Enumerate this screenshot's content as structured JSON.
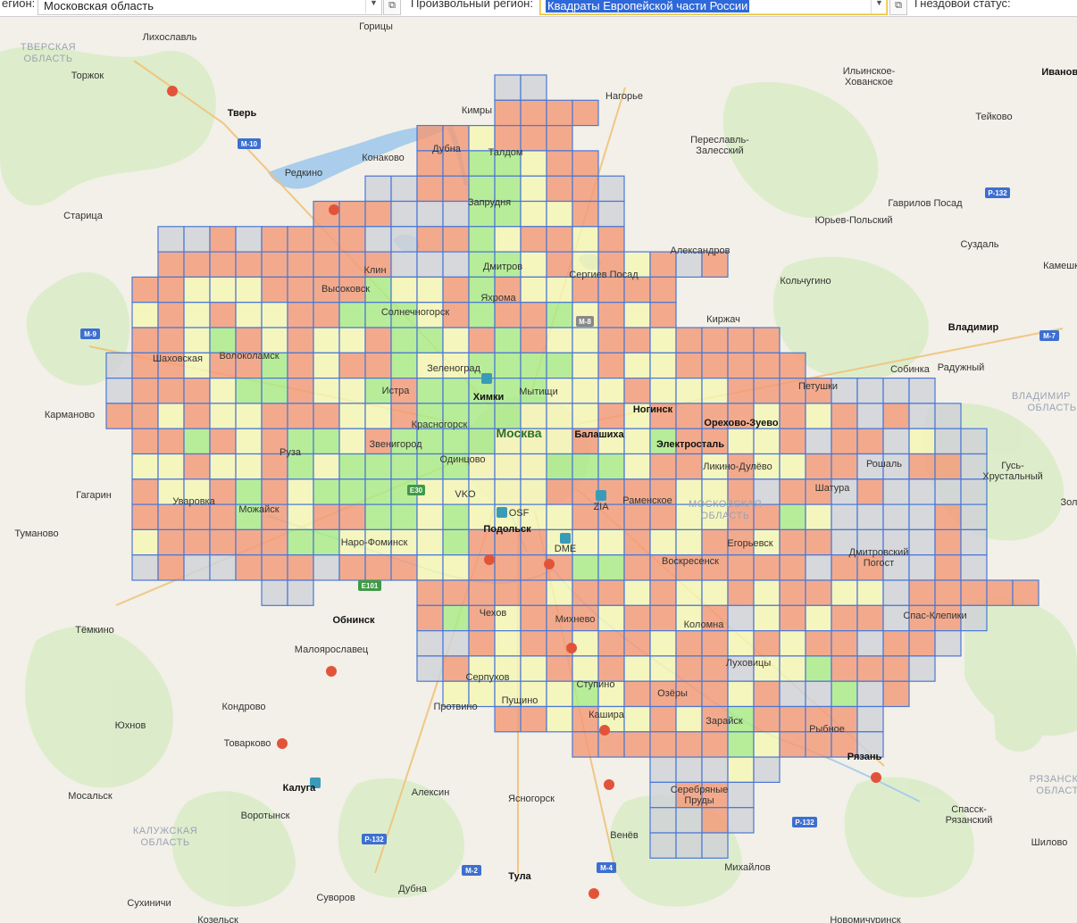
{
  "toolbar": {
    "region_label": "егион:",
    "region_value": "Московская область",
    "custom_region_label": "Произвольный регион:",
    "custom_region_value": "Квадраты Европейской части России",
    "nest_status_label": "Гнездовой статус:",
    "dropdown_icon": "chevron-down-icon",
    "copy_icon": "copy-icon"
  },
  "legend_colors": {
    "orange": "#f39a78",
    "yellow": "#f5f7b5",
    "green": "#a9ec86",
    "gray": "#cfd2d8",
    "grid_border": "#4a78d6"
  },
  "places": {
    "tverskaya_oblast_1": "ТВЕРСКАЯ",
    "tverskaya_oblast_2": "ОБЛАСТЬ",
    "likhoslavl": "Лихославль",
    "torzhok": "Торжок",
    "tver": "Тверь",
    "gorisy": "Горицы",
    "kimry": "Кимры",
    "nagorye": "Нагорье",
    "ilinskoe_1": "Ильинское-",
    "ilinskoe_2": "Хованское",
    "ivanovo": "Иваново",
    "teykovo": "Тейково",
    "pereslavl_1": "Переславль-",
    "pereslavl_2": "Залесский",
    "konakovo": "Конаково",
    "redkino": "Редкино",
    "dubna": "Дубна",
    "taldom": "Талдом",
    "zaprudnya": "Запрудня",
    "staritsa": "Старица",
    "gavrilov_posad": "Гаврилов Посад",
    "yuryev_polsky": "Юрьев-Польский",
    "suzdal": "Суздаль",
    "kameshkovo": "Камешк",
    "aleksandrov": "Александров",
    "klin": "Клин",
    "vysokovsk": "Высоковск",
    "dmitrov": "Дмитров",
    "sergiev_posad": "Сергиев Посад",
    "yakhroma": "Яхрома",
    "kolchugino": "Кольчугино",
    "solnechnogorsk": "Солнечногорск",
    "kirzhach": "Киржач",
    "vladimir": "Владимир",
    "shakhovskaya": "Шаховская",
    "volokolamsk": "Волоколамск",
    "zelenograd": "Зеленоград",
    "sobinka": "Собинка",
    "raduzhny": "Радужный",
    "khimki": "Химки",
    "mytishchi": "Мытищи",
    "petushki": "Петушки",
    "istra": "Истра",
    "karmanovo": "Карманово",
    "krasnogorsk": "Красногорск",
    "moskva": "Москва",
    "balashikha": "Балашиха",
    "noginsk": "Ногинск",
    "orekhovo_zuevo": "Орехово-Зуево",
    "vladimir_oblast_1": "ВЛАДИМИР",
    "vladimir_oblast_2": "ОБЛАСТЬ",
    "zvenigorod": "Звенигород",
    "elektrostal": "Электросталь",
    "ruza": "Руза",
    "odintsovo": "Одинцово",
    "likino_dulyovo": "Ликино-Дулёво",
    "roshal": "Рошаль",
    "gus_1": "Гусь-",
    "gus_2": "Хрустальный",
    "gagarin": "Гагарин",
    "vko": "VKO",
    "shatura": "Шатура",
    "uvarovka": "Уваровка",
    "zia": "ZIA",
    "ramenskoe": "Раменское",
    "mo_oblast_1": "МОСКОВСКАЯ",
    "mo_oblast_2": "ОБЛАСТЬ",
    "zol": "Зол",
    "mozhaysk": "Можайск",
    "osf": "OSF",
    "tumanovo": "Туманово",
    "podolsk": "Подольск",
    "naro_fominsk": "Наро-Фоминск",
    "dme": "DME",
    "egoryevsk": "Егорьевск",
    "dmitrovsky_pogost_1": "Дмитровский",
    "dmitrovsky_pogost_2": "Погост",
    "voskresensk": "Воскресенск",
    "obninsk": "Обнинск",
    "chekhov": "Чехов",
    "mikhnevo": "Михнево",
    "spas_klepiki": "Спас-Клепики",
    "temkino": "Тёмкино",
    "kolomna": "Коломна",
    "maloyaroslavets": "Малоярославец",
    "lukhovitsy": "Луховицы",
    "serpukhov": "Серпухов",
    "stupino": "Ступино",
    "ozyory": "Озёры",
    "pushchino": "Пущино",
    "protvino": "Протвино",
    "kondrovo": "Кондрово",
    "kashira": "Кашира",
    "zaraysk": "Зарайск",
    "yukhnov": "Юхнов",
    "rybnoe": "Рыбное",
    "tovarkovo": "Товарково",
    "ryazan": "Рязань",
    "kaluga": "Калуга",
    "aleksin": "Алексин",
    "yasnogorsk": "Ясногорск",
    "serebryanye_1": "Серебряные",
    "serebryanye_2": "Пруды",
    "ryazan_oblast_1": "РЯЗАНСК",
    "ryazan_oblast_2": "ОБЛАСТ",
    "mosalsk": "Мосальск",
    "vorotynsk": "Воротынск",
    "spassk_1": "Спасск-",
    "spassk_2": "Рязанский",
    "kaluga_oblast_1": "КАЛУЖСКАЯ",
    "kaluga_oblast_2": "ОБЛАСТЬ",
    "venyov": "Венёв",
    "shilovo": "Шилово",
    "mikhaylov": "Михайлов",
    "tula": "Тула",
    "sukhinichi": "Сухиничи",
    "suvorov": "Суворов",
    "dubna_tula": "Дубна",
    "kozelsk": "Козельск",
    "novomichurinsk": "Новомичуринск"
  },
  "roads": {
    "m10": "M-10",
    "m9": "M-9",
    "m8": "M-8",
    "m7": "M-7",
    "r132": "P-132",
    "r132b": "P-132",
    "r132c": "P-132",
    "m2": "M-2",
    "m4": "M-4",
    "e30": "E30",
    "e101": "E101"
  }
}
